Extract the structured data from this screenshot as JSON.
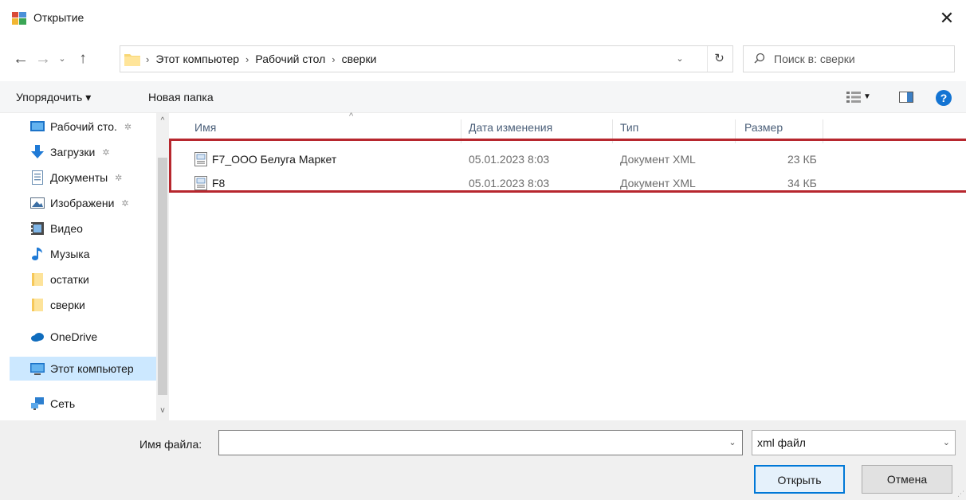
{
  "window": {
    "title": "Открытие",
    "close_glyph": "✕"
  },
  "nav": {
    "back": "←",
    "forward": "→",
    "recent": "⌄",
    "up": "↑",
    "breadcrumbs": [
      "Этот компьютер",
      "Рабочий стол",
      "сверки"
    ],
    "separator": "›",
    "refresh": "↻",
    "search_placeholder": "Поиск в: сверки"
  },
  "toolbar": {
    "organize": "Упорядочить ▾",
    "new_folder": "Новая папка",
    "view_dropdown": "▼",
    "help": "?"
  },
  "sidebar": {
    "items": [
      {
        "label": "Рабочий сто.",
        "icon": "desktop-icon",
        "pinned": true
      },
      {
        "label": "Загрузки",
        "icon": "download-icon",
        "pinned": true
      },
      {
        "label": "Документы",
        "icon": "document-icon",
        "pinned": true
      },
      {
        "label": "Изображени",
        "icon": "image-icon",
        "pinned": true
      },
      {
        "label": "Видео",
        "icon": "video-icon",
        "pinned": false
      },
      {
        "label": "Музыка",
        "icon": "music-icon",
        "pinned": false
      },
      {
        "label": "остатки",
        "icon": "folder-icon",
        "pinned": false
      },
      {
        "label": "сверки",
        "icon": "folder-icon",
        "pinned": false
      },
      {
        "label": "OneDrive",
        "icon": "cloud-icon",
        "pinned": false
      },
      {
        "label": "Этот компьютер",
        "icon": "computer-icon",
        "pinned": false,
        "selected": true
      },
      {
        "label": "Сеть",
        "icon": "network-icon",
        "pinned": false
      }
    ],
    "pin_glyph": "✲",
    "scroll_up": "^",
    "scroll_down": "v"
  },
  "columns": {
    "name": "Имя",
    "date": "Дата изменения",
    "type": "Тип",
    "size": "Размер",
    "sort_glyph": "^"
  },
  "files": [
    {
      "name": "F7_ООО  Белуга Маркет",
      "date": "05.01.2023 8:03",
      "type": "Документ XML",
      "size": "23 КБ"
    },
    {
      "name": "F8",
      "date": "05.01.2023 8:03",
      "type": "Документ XML",
      "size": "34 КБ"
    }
  ],
  "footer": {
    "filename_label": "Имя файла:",
    "filename_value": "",
    "filetype_value": "xml файл",
    "dropdown_glyph": "⌄",
    "open_button": "Открыть",
    "cancel_button": "Отмена"
  },
  "colors": {
    "accent": "#0078d7",
    "highlight_box": "#b7272e",
    "selected_bg": "#cce8ff"
  }
}
